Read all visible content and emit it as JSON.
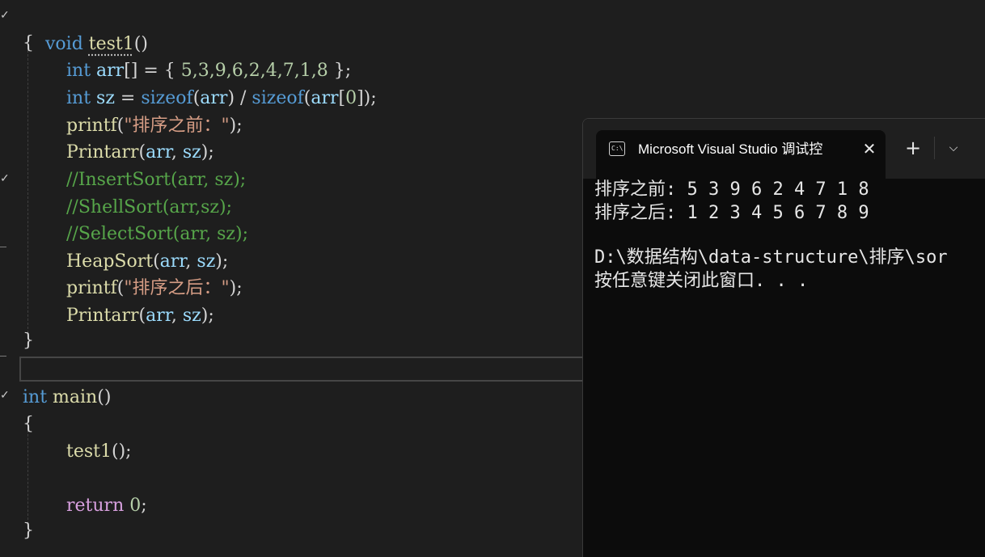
{
  "editor": {
    "lines": {
      "l1": {
        "kw": "void",
        "fn": "test1",
        "rest": "()"
      },
      "l2": {
        "text": "{"
      },
      "l3": {
        "kw": "int",
        "var": "arr",
        "p1": "[] = { ",
        "nums": "5,3,9,6,2,4,7,1,8",
        "p2": " };"
      },
      "l4": {
        "kw": "int",
        "var": "sz",
        "p1": " = ",
        "kw2": "sizeof",
        "p2": "(",
        "var2": "arr",
        "p3": ") / ",
        "kw3": "sizeof",
        "p4": "(",
        "var3": "arr",
        "p5": "[",
        "num": "0",
        "p6": "]);"
      },
      "l5": {
        "fn": "printf",
        "p1": "(",
        "str": "\"排序之前：\"",
        "p2": ");"
      },
      "l6": {
        "fn": "Printarr",
        "p1": "(",
        "var1": "arr",
        "p2": ", ",
        "var2": "sz",
        "p3": ");"
      },
      "l7": {
        "cmt": "//InsertSort(arr, sz);"
      },
      "l8": {
        "cmt": "//ShellSort(arr,sz);"
      },
      "l9": {
        "cmt": "//SelectSort(arr, sz);"
      },
      "l10": {
        "fn": "HeapSort",
        "p1": "(",
        "var1": "arr",
        "p2": ", ",
        "var2": "sz",
        "p3": ");"
      },
      "l11": {
        "fn": "printf",
        "p1": "(",
        "str": "\"排序之后：\"",
        "p2": ");"
      },
      "l12": {
        "fn": "Printarr",
        "p1": "(",
        "var1": "arr",
        "p2": ", ",
        "var2": "sz",
        "p3": ");"
      },
      "l13": {
        "text": "}"
      },
      "l14": {
        "kw": "int",
        "fn": "main",
        "rest": "()"
      },
      "l15": {
        "text": "{"
      },
      "l16": {
        "fn": "test1",
        "rest": "();"
      },
      "l17": {
        "ctl": "return",
        "num": "0",
        "rest": ";"
      },
      "l18": {
        "text": "}"
      }
    }
  },
  "terminal": {
    "tab_title": "Microsoft Visual Studio 调试控",
    "tab_icon": "C:\\",
    "close_glyph": "✕",
    "new_tab_glyph": "+",
    "dropdown_glyph": "⌵",
    "output": [
      "排序之前: 5 3 9 6 2 4 7 1 8",
      "排序之后: 1 2 3 4 5 6 7 8 9",
      "",
      "D:\\数据结构\\data-structure\\排序\\sor",
      "按任意键关闭此窗口. . ."
    ]
  }
}
